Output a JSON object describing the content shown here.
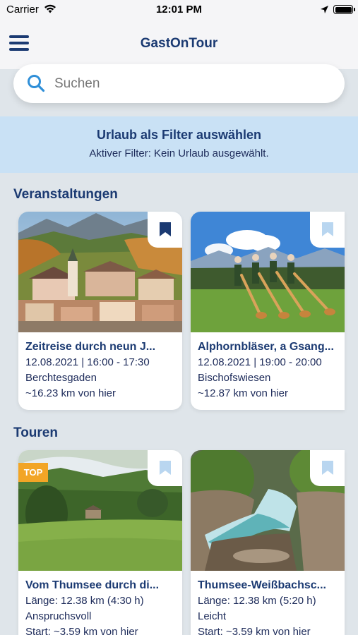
{
  "status_bar": {
    "carrier": "Carrier",
    "time": "12:01 PM"
  },
  "nav": {
    "title": "GastOnTour"
  },
  "search": {
    "placeholder": "Suchen"
  },
  "filter": {
    "title": "Urlaub als Filter auswählen",
    "subtitle": "Aktiver Filter: Kein Urlaub ausgewählt."
  },
  "sections": {
    "events": {
      "title": "Veranstaltungen",
      "cards": [
        {
          "title": "Zeitreise durch neun J...",
          "datetime": "12.08.2021 | 16:00 - 17:30",
          "location": "Berchtesgaden",
          "distance": "~16.23 km von hier",
          "bookmarked": true
        },
        {
          "title": "Alphornbläser, a Gsang...",
          "datetime": "12.08.2021 | 19:00 - 20:00",
          "location": "Bischofswiesen",
          "distance": "~12.87 km von hier",
          "bookmarked": false
        }
      ]
    },
    "tours": {
      "title": "Touren",
      "cards": [
        {
          "badge": "TOP",
          "title": "Vom Thumsee durch di...",
          "length": "Länge: 12.38 km (4:30 h)",
          "difficulty": "Anspruchsvoll",
          "start": "Start: ~3.59 km von hier",
          "bookmarked": false
        },
        {
          "title": "Thumsee-Weißbachsc...",
          "length": "Länge: 12.38 km (5:20 h)",
          "difficulty": "Leicht",
          "start": "Start: ~3.59 km von hier",
          "bookmarked": false
        }
      ]
    }
  },
  "icons": [
    "wifi-icon",
    "location-arrow-icon",
    "battery-icon",
    "hamburger-menu-icon",
    "search-icon",
    "bookmark-icon"
  ],
  "colors": {
    "primary": "#1b3a72",
    "accent_light": "#c9e1f5",
    "badge": "#f2a526",
    "bookmark_inactive": "#b9d6f0"
  }
}
